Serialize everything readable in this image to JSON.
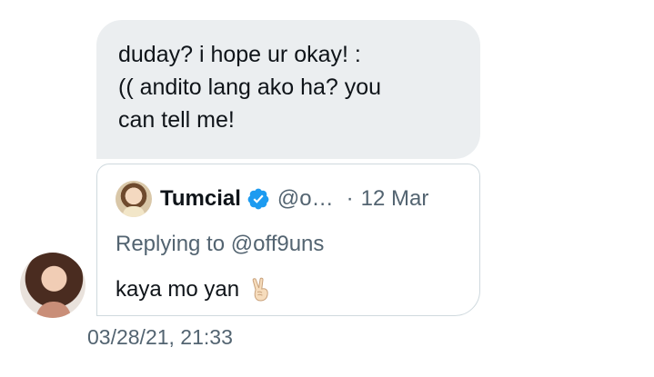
{
  "message": {
    "lines": [
      "duday? i hope ur okay! :",
      "(( andito lang ako ha? you",
      "can tell me!"
    ]
  },
  "quoted_tweet": {
    "author_name": "Tumcial",
    "author_handle": "@o…",
    "separator": "·",
    "date": "12 Mar",
    "replying_prefix": "Replying to",
    "replying_handle": "@off9uns",
    "text": "kaya mo yan",
    "emoji": "victory-hand-icon",
    "verified": true
  },
  "timestamp": "03/28/21, 21:33",
  "colors": {
    "bubble": "#ebeef0",
    "border": "#cfd9de",
    "secondary_text": "#536471",
    "verified_blue": "#1d9bf0"
  }
}
